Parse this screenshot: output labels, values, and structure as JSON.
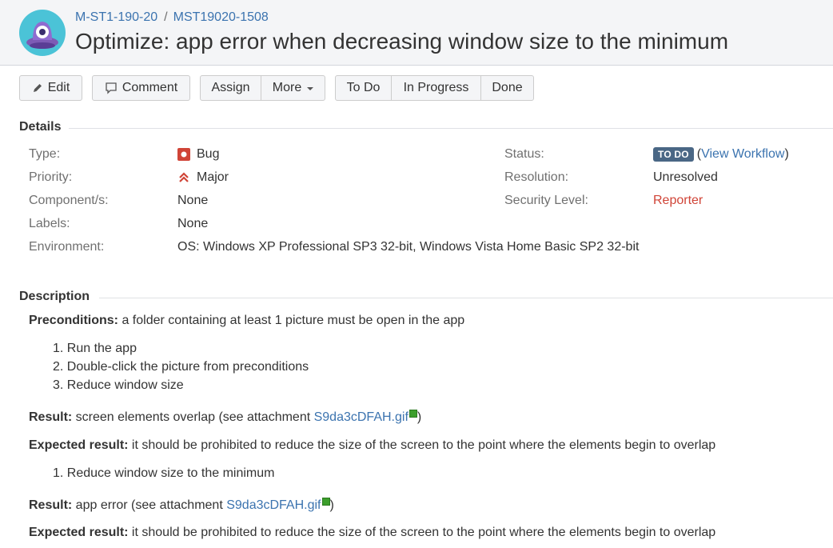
{
  "breadcrumbs": {
    "project": "M-ST1-190-20",
    "separator": "/",
    "issue_key": "MST19020-1508"
  },
  "title": "Optimize: app error when decreasing window size to the minimum",
  "toolbar": {
    "edit": "Edit",
    "comment": "Comment",
    "assign": "Assign",
    "more": "More",
    "todo": "To Do",
    "in_progress": "In Progress",
    "done": "Done"
  },
  "details": {
    "heading": "Details",
    "type_label": "Type:",
    "type_value": "Bug",
    "priority_label": "Priority:",
    "priority_value": "Major",
    "component_label": "Component/s:",
    "component_value": "None",
    "labels_label": "Labels:",
    "labels_value": "None",
    "environment_label": "Environment:",
    "environment_value": "OS: Windows XP Professional SP3 32-bit, Windows Vista Home Basic SP2 32-bit",
    "status_label": "Status:",
    "status_value": "TO DO",
    "view_workflow_open": "(",
    "view_workflow": "View Workflow",
    "view_workflow_close": ")",
    "resolution_label": "Resolution:",
    "resolution_value": "Unresolved",
    "security_label": "Security Level:",
    "security_value": "Reporter"
  },
  "description": {
    "heading": "Description",
    "preconditions_label": "Preconditions:",
    "preconditions_text": " a folder containing at least 1 picture must be open in the app",
    "steps": [
      "1. Run the app",
      "2. Double-click the picture from preconditions",
      "3. Reduce window size"
    ],
    "result1_label": "Result:",
    "result1_text": " screen elements overlap (see attachment ",
    "result1_link": "S9da3cDFAH.gif",
    "result1_close": ")",
    "expected1_label": "Expected result:",
    "expected1_text": " it should be prohibited to reduce the size of the screen to the point where the elements begin to overlap",
    "steps2": [
      "1. Reduce window size to the minimum"
    ],
    "result2_label": "Result:",
    "result2_text": " app error (see attachment ",
    "result2_link": "S9da3cDFAH.gif",
    "result2_close": ")",
    "expected2_label": "Expected result:",
    "expected2_text": " it should be prohibited to reduce the size of the screen to the point where the elements begin to overlap"
  },
  "colors": {
    "link": "#3b73af",
    "status_lozenge": "#4a6785",
    "reporter": "#d04437",
    "bug": "#d04437",
    "priority_major": "#d04437"
  },
  "icons": {
    "avatar": "project-avatar",
    "edit": "pencil-icon",
    "comment": "speech-bubble-icon",
    "bug": "bug-icon",
    "priority": "major-priority-icon",
    "attachment": "attachment-icon"
  }
}
